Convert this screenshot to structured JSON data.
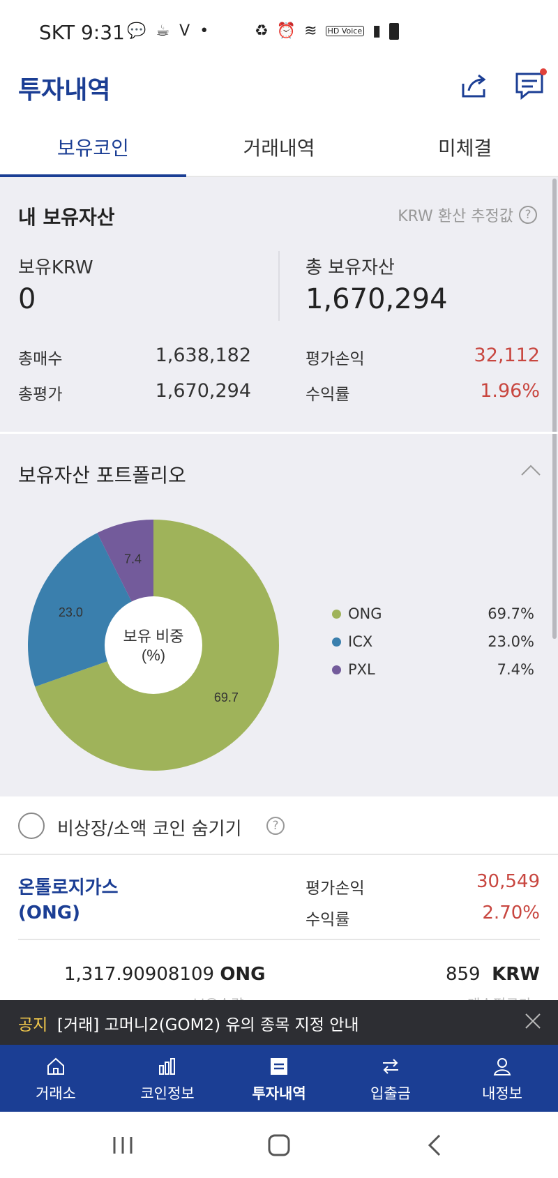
{
  "status_bar": {
    "carrier_time": "SKT 9:31",
    "left_icons": [
      "talk-icon",
      "coffee-icon",
      "v-icon"
    ],
    "hd_label": "HD Voice",
    "right_icons": [
      "recycle-icon",
      "alarm-icon",
      "wifi-icon",
      "signal-icon",
      "battery-icon"
    ]
  },
  "header": {
    "title": "투자내역"
  },
  "tabs": [
    {
      "label": "보유코인",
      "active": true
    },
    {
      "label": "거래내역",
      "active": false
    },
    {
      "label": "미체결",
      "active": false
    }
  ],
  "assets": {
    "title": "내 보유자산",
    "krw_note": "KRW 환산 추정값",
    "held_krw_label": "보유KRW",
    "held_krw_value": "0",
    "total_assets_label": "총 보유자산",
    "total_assets_value": "1,670,294",
    "total_buy_label": "총매수",
    "total_buy_value": "1,638,182",
    "total_eval_label": "총평가",
    "total_eval_value": "1,670,294",
    "pnl_label": "평가손익",
    "pnl_value": "32,112",
    "return_label": "수익률",
    "return_value": "1.96%"
  },
  "portfolio": {
    "title": "보유자산 포트폴리오",
    "center_line1": "보유 비중",
    "center_line2": "(%)"
  },
  "chart_data": {
    "type": "pie",
    "categories": [
      "ONG",
      "ICX",
      "PXL"
    ],
    "values": [
      69.7,
      23.0,
      7.4
    ],
    "slice_labels": [
      "69.7",
      "23.0",
      "7.4"
    ],
    "legend_pct": [
      "69.7%",
      "23.0%",
      "7.4%"
    ],
    "colors": [
      "#9fb35a",
      "#3a7fad",
      "#735b9b"
    ],
    "legend_position": "right"
  },
  "hide_toggle": {
    "label": "비상장/소액 코인 숨기기"
  },
  "coin": {
    "name_line1": "온톨로지가스",
    "name_line2": "(ONG)",
    "pnl_label": "평가손익",
    "pnl_value": "30,549",
    "return_label": "수익률",
    "return_value": "2.70%",
    "quantity": "1,317.90908109",
    "quantity_unit": "ONG",
    "quantity_label": "보유수량",
    "avg_price": "859",
    "avg_price_unit": "KRW",
    "avg_price_label": "매수평균가"
  },
  "notice": {
    "tag": "공지",
    "text": "[거래] 고머니2(GOM2) 유의 종목 지정 안내"
  },
  "bottom_nav": [
    {
      "label": "거래소",
      "icon": "home-icon"
    },
    {
      "label": "코인정보",
      "icon": "chart-icon"
    },
    {
      "label": "투자내역",
      "icon": "list-icon",
      "active": true
    },
    {
      "label": "입출금",
      "icon": "transfer-icon"
    },
    {
      "label": "내정보",
      "icon": "user-icon"
    }
  ]
}
